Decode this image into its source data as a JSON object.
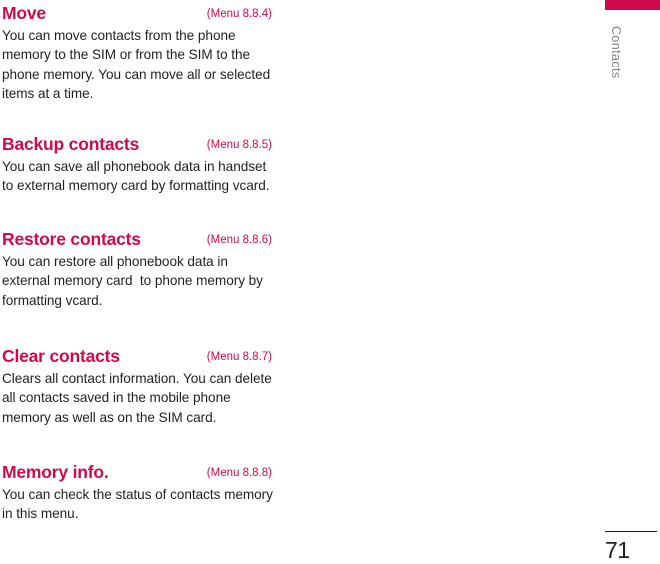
{
  "page": {
    "number": "71",
    "side_tab_label": "Contacts",
    "accent_color": "#CC0B4E",
    "body_color": "#231F20",
    "side_tab_color": "#808285"
  },
  "sections": [
    {
      "title": "Move",
      "menu": "(Menu 8.8.4)",
      "body_lines": [
        "You can move contacts from the phone",
        "memory to the SIM or from the SIM to the",
        "phone memory. You can move all or selected",
        "items at a time."
      ]
    },
    {
      "title": "Backup contacts",
      "menu": "(Menu 8.8.5)",
      "body_lines": [
        "You can save all phonebook data in handset",
        "to external memory card by formatting vcard."
      ]
    },
    {
      "title": "Restore contacts",
      "menu": "(Menu 8.8.6)",
      "body_lines": [
        "You can restore all phonebook data in",
        "external memory card  to phone memory by",
        "formatting vcard."
      ]
    },
    {
      "title": "Clear contacts",
      "menu": "(Menu 8.8.7)",
      "body_lines": [
        "Clears all contact information. You can delete",
        "all contacts saved in the mobile phone",
        "memory as well as on the SIM card."
      ]
    },
    {
      "title": "Memory info.",
      "menu": "(Menu 8.8.8)",
      "body_lines": [
        "You can check the status of contacts memory",
        "in this menu."
      ]
    }
  ]
}
